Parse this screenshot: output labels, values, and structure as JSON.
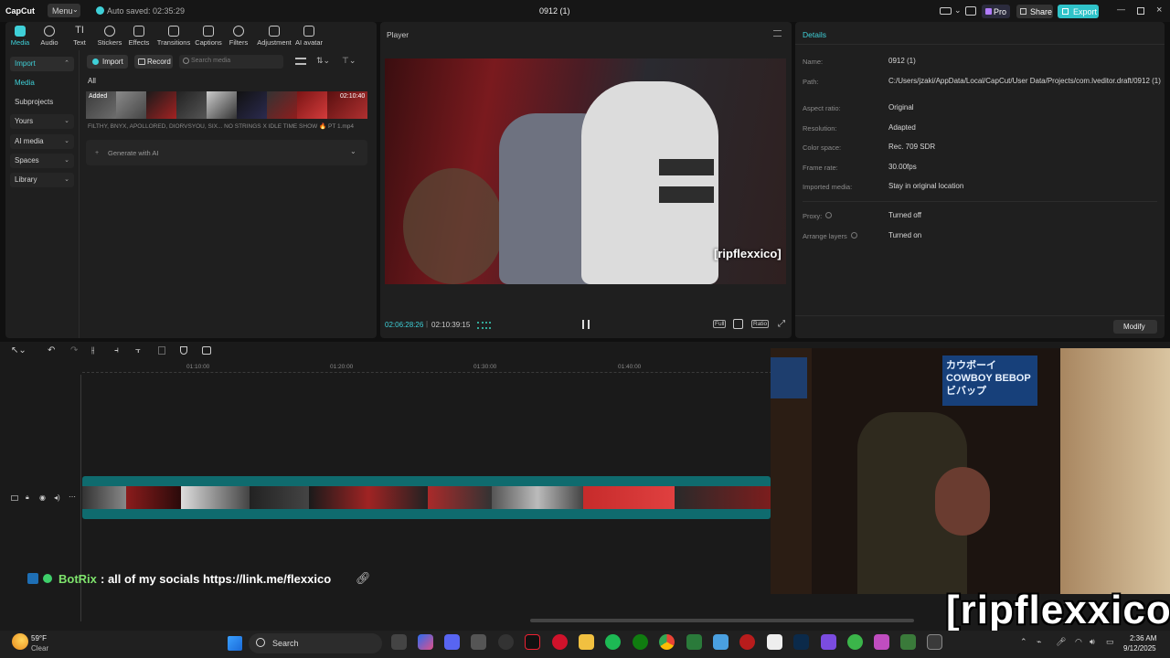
{
  "titlebar": {
    "app_name": "CapCut",
    "menu_label": "Menu",
    "autosave": "Auto saved: 02:35:29",
    "project_title": "0912 (1)",
    "pro_label": "Pro",
    "share_label": "Share",
    "export_label": "Export"
  },
  "toolbar": {
    "tabs": [
      {
        "label": "Media",
        "icon": "media-icon"
      },
      {
        "label": "Audio",
        "icon": "audio-icon"
      },
      {
        "label": "Text",
        "icon": "text-icon"
      },
      {
        "label": "Stickers",
        "icon": "stickers-icon"
      },
      {
        "label": "Effects",
        "icon": "effects-icon"
      },
      {
        "label": "Transitions",
        "icon": "transitions-icon"
      },
      {
        "label": "Captions",
        "icon": "captions-icon"
      },
      {
        "label": "Filters",
        "icon": "filters-icon"
      },
      {
        "label": "Adjustment",
        "icon": "adjustment-icon"
      },
      {
        "label": "AI avatar",
        "icon": "ai-avatar-icon"
      }
    ]
  },
  "sidebar": {
    "items": [
      {
        "label": "Import"
      },
      {
        "label": "Media"
      },
      {
        "label": "Subprojects"
      },
      {
        "label": "Yours"
      },
      {
        "label": "AI media"
      },
      {
        "label": "Spaces"
      },
      {
        "label": "Library"
      }
    ]
  },
  "media": {
    "import_label": "Import",
    "record_label": "Record",
    "search_placeholder": "Search media",
    "filter_all": "All",
    "clip_badge": "Added",
    "clip_duration": "02:10:40",
    "clip_name": "FILTHY, BNYX, APOLLORED, DIORVSYOU, SIX... NO STRINGS X IDLE TIME SHOW 🔥 PT 1.mp4",
    "generate_ai": "Generate with AI"
  },
  "player": {
    "title": "Player",
    "watermark": "[ripflexxico]",
    "current_time": "02:06:28:26",
    "total_time": "02:10:39:15",
    "full_label": "Full",
    "ratio_label": "Ratio"
  },
  "details": {
    "title": "Details",
    "rows": [
      {
        "label": "Name:",
        "value": "0912 (1)"
      },
      {
        "label": "Path:",
        "value": "C:/Users/jzaki/AppData/Local/CapCut/User Data/Projects/com.lveditor.draft/0912 (1)"
      },
      {
        "label": "Aspect ratio:",
        "value": "Original"
      },
      {
        "label": "Resolution:",
        "value": "Adapted"
      },
      {
        "label": "Color space:",
        "value": "Rec. 709 SDR"
      },
      {
        "label": "Frame rate:",
        "value": "30.00fps"
      },
      {
        "label": "Imported media:",
        "value": "Stay in original location"
      },
      {
        "label": "Proxy:",
        "value": "Turned off"
      },
      {
        "label": "Arrange layers",
        "value": "Turned on"
      }
    ],
    "modify_label": "Modify"
  },
  "timeline": {
    "ticks": [
      "01:10:00",
      "01:20:00",
      "01:30:00",
      "01:40:00"
    ]
  },
  "overlay": {
    "chat_user": "BotRix",
    "chat_message": ": all of my socials https://link.me/flexxico",
    "stream_watermark": "[ripflexxico]",
    "poster_text": "カウボーイ COWBOY BEBOP ビバップ"
  },
  "taskbar": {
    "weather_temp": "59°F",
    "weather_desc": "Clear",
    "search_label": "Search",
    "time": "2:36 AM",
    "date": "9/12/2025"
  }
}
